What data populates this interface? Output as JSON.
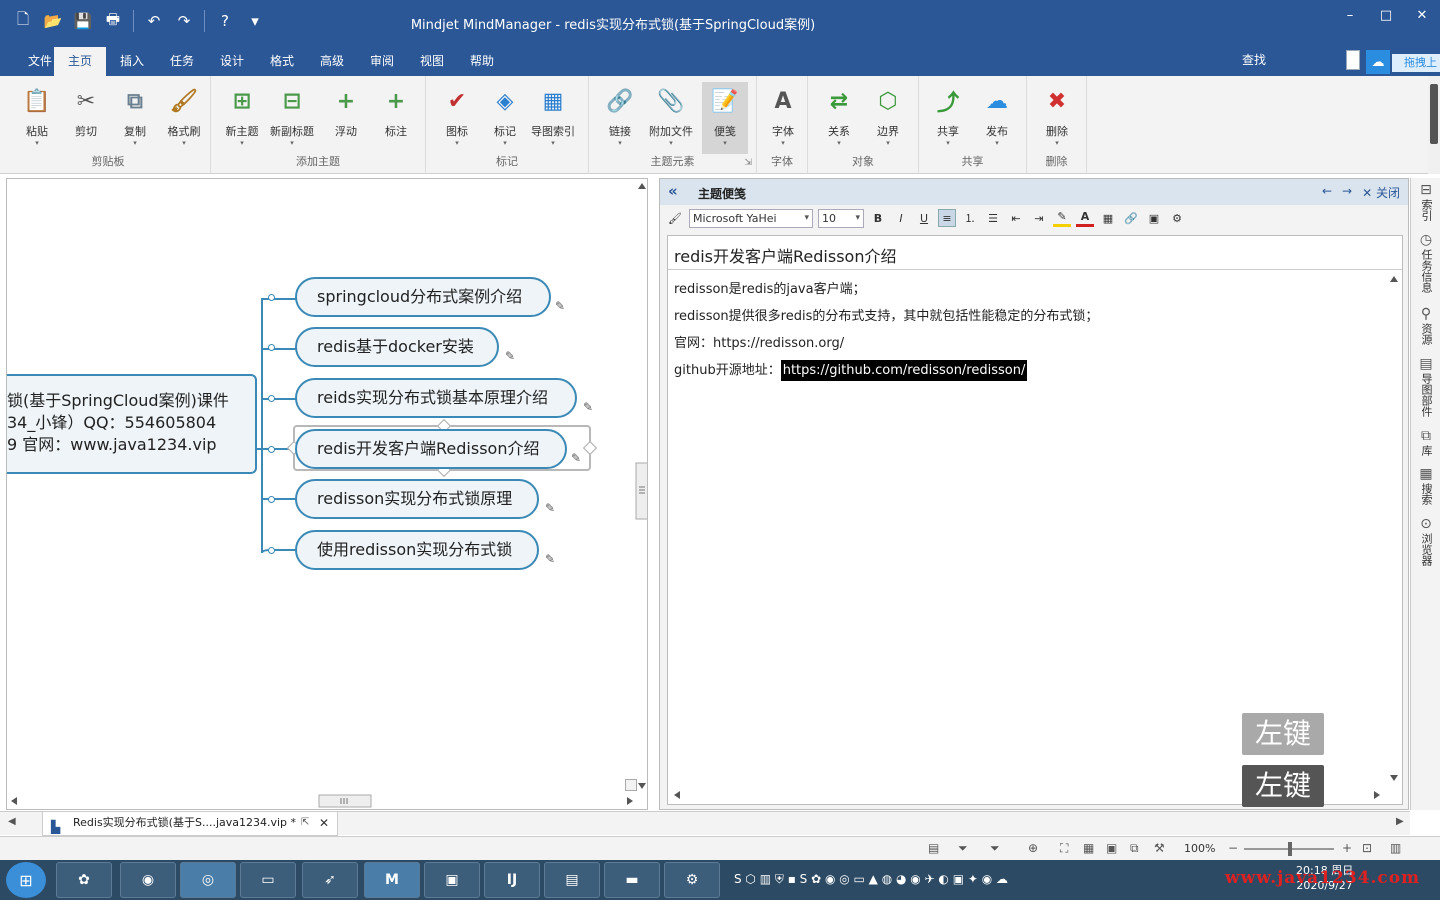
{
  "window": {
    "title": "Mindjet MindManager - redis实现分布式锁(基于SpringCloud案例)",
    "controls": {
      "minimize": "–",
      "maximize": "□",
      "close": "✕"
    }
  },
  "quick_access": [
    {
      "name": "new-icon",
      "glyph": "🗋"
    },
    {
      "name": "open-icon",
      "glyph": "📂"
    },
    {
      "name": "save-icon",
      "glyph": "💾"
    },
    {
      "name": "print-icon",
      "glyph": "🖶"
    },
    {
      "name": "undo-icon",
      "glyph": "↶"
    },
    {
      "name": "redo-icon",
      "glyph": "↷"
    },
    {
      "name": "help-icon",
      "glyph": "?"
    },
    {
      "name": "customize-icon",
      "glyph": "▾"
    }
  ],
  "menu_tabs": [
    "文件",
    "主页",
    "插入",
    "任务",
    "设计",
    "格式",
    "高级",
    "审阅",
    "视图",
    "帮助"
  ],
  "menu_active_index": 1,
  "search_label": "查找",
  "drag_upload_label": "拖拽上",
  "ribbon": {
    "groups": [
      {
        "label": "剪贴板",
        "buttons": [
          {
            "label": "粘贴",
            "icon": "paste-icon",
            "glyph": "📋",
            "color": "#6a7f8f",
            "dropdown": true
          },
          {
            "label": "剪切",
            "icon": "scissors-icon",
            "glyph": "✂",
            "color": "#555555",
            "dropdown": false
          },
          {
            "label": "复制",
            "icon": "copy-icon",
            "glyph": "⧉",
            "color": "#6a7f8f",
            "dropdown": true
          },
          {
            "label": "格式刷",
            "icon": "format-painter-icon",
            "glyph": "🖌",
            "color": "#b07820",
            "dropdown": true
          }
        ]
      },
      {
        "label": "添加主题",
        "buttons": [
          {
            "label": "新主题",
            "icon": "new-topic-icon",
            "glyph": "⊞",
            "color": "#4a9a4a",
            "dropdown": true
          },
          {
            "label": "新副标题",
            "icon": "new-subtopic-icon",
            "glyph": "⊟",
            "color": "#4a9a4a",
            "dropdown": true
          },
          {
            "label": "浮动",
            "icon": "floating-topic-icon",
            "glyph": "+",
            "color": "#4a9a4a",
            "dropdown": false
          },
          {
            "label": "标注",
            "icon": "callout-icon",
            "glyph": "+",
            "color": "#4a9a4a",
            "dropdown": false
          }
        ]
      },
      {
        "label": "标记",
        "buttons": [
          {
            "label": "图标",
            "icon": "icon-marker-icon",
            "glyph": "✔",
            "color": "#c03030",
            "dropdown": true
          },
          {
            "label": "标记",
            "icon": "tag-icon",
            "glyph": "◈",
            "color": "#2b7fd0",
            "dropdown": true
          },
          {
            "label": "导图索引",
            "icon": "map-index-icon",
            "glyph": "▦",
            "color": "#2b7fd0",
            "dropdown": true
          }
        ]
      },
      {
        "label": "主题元素",
        "buttons": [
          {
            "label": "链接",
            "icon": "link-icon",
            "glyph": "🔗",
            "color": "#2b7fd0",
            "dropdown": true
          },
          {
            "label": "附加文件",
            "icon": "attachment-icon",
            "glyph": "📎",
            "color": "#777777",
            "dropdown": true
          },
          {
            "label": "便笺",
            "icon": "notes-icon",
            "glyph": "📝",
            "color": "#555555",
            "dropdown": true,
            "pressed": true
          }
        ]
      },
      {
        "label": "字体",
        "buttons": [
          {
            "label": "字体",
            "icon": "font-icon",
            "glyph": "A",
            "color": "#555555",
            "dropdown": true
          }
        ]
      },
      {
        "label": "对象",
        "buttons": [
          {
            "label": "关系",
            "icon": "relationship-icon",
            "glyph": "⇄",
            "color": "#3a9a3a",
            "dropdown": true
          },
          {
            "label": "边界",
            "icon": "boundary-icon",
            "glyph": "⬡",
            "color": "#3a9a3a",
            "dropdown": true
          }
        ]
      },
      {
        "label": "共享",
        "buttons": [
          {
            "label": "共享",
            "icon": "share-icon",
            "glyph": "⤴",
            "color": "#3a9a3a",
            "dropdown": true
          },
          {
            "label": "发布",
            "icon": "publish-icon",
            "glyph": "☁",
            "color": "#2b8de0",
            "dropdown": true
          }
        ]
      },
      {
        "label": "删除",
        "buttons": [
          {
            "label": "删除",
            "icon": "delete-icon",
            "glyph": "✖",
            "color": "#d03030",
            "dropdown": true
          }
        ]
      }
    ]
  },
  "mindmap": {
    "central_topic_lines": [
      "锁(基于SpringCloud案例)课件",
      "34_小锋）QQ：554605804",
      "9 官网：www.java1234.vip"
    ],
    "subtopics": [
      "springcloud分布式案例介绍",
      "redis基于docker安装",
      "reids实现分布式锁基本原理介绍",
      "redis开发客户端Redisson介绍",
      "redisson实现分布式锁原理",
      "使用redisson实现分布式锁"
    ],
    "selected_index": 3
  },
  "notes_panel": {
    "title": "主题便笺",
    "close_label": "关闭",
    "font": "Microsoft YaHei",
    "font_size": "10",
    "topic_title": "redis开发客户端Redisson介绍",
    "lines": [
      {
        "text": "redisson是redis的java客户端；"
      },
      {
        "text": "redisson提供很多redis的分布式支持，其中就包括性能稳定的分布式锁；"
      },
      {
        "text": "官网：https://redisson.org/"
      },
      {
        "text": "github开源地址：",
        "highlight": "https://github.com/redisson/redisson/"
      }
    ]
  },
  "overlay_labels": [
    "左键",
    "左键"
  ],
  "right_sidebar_tabs": [
    {
      "label": "索引",
      "icon": "index-icon"
    },
    {
      "label": "任务信息",
      "icon": "task-info-icon"
    },
    {
      "label": "资源",
      "icon": "resources-icon"
    },
    {
      "label": "导图部件",
      "icon": "map-parts-icon"
    },
    {
      "label": "库",
      "icon": "library-icon"
    },
    {
      "label": "搜索",
      "icon": "search-pane-icon"
    },
    {
      "label": "浏览器",
      "icon": "browser-icon"
    }
  ],
  "document_tab": {
    "label": "Redis实现分布式锁(基于S....java1234.vip *"
  },
  "status": {
    "zoom": "100%"
  },
  "taskbar": {
    "apps": [
      "start",
      "colors",
      "qq-browser",
      "chrome",
      "remote-desktop",
      "unknown",
      "mindmanager",
      "file-manager",
      "intellij",
      "explorer",
      "remote",
      "gear"
    ],
    "clock_time": "20:18 周日",
    "clock_date": "2020/9/27"
  },
  "watermark": "www.java1234.com",
  "colors": {
    "titlebar": "#2b5797",
    "topic_border": "#3b89b6",
    "topic_fill": "#eef4f8"
  }
}
